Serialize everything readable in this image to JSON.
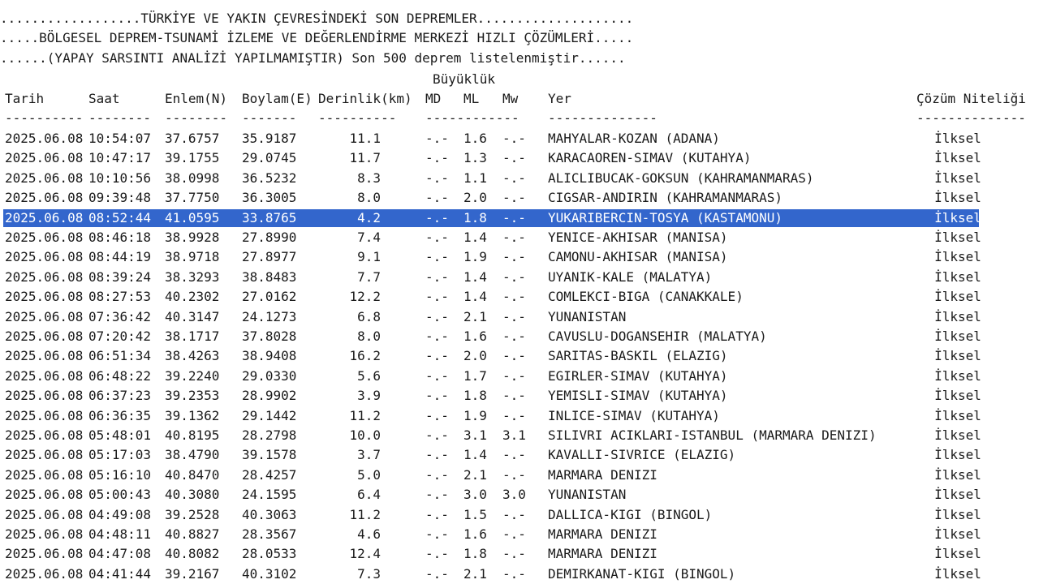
{
  "header": {
    "line1": "..................TÜRKİYE VE YAKIN ÇEVRESİNDEKİ SON DEPREMLER....................",
    "line2": ".....BÖLGESEL DEPREM-TSUNAMİ İZLEME VE DEĞERLENDİRME MERKEZİ HIZLI ÇÖZÜMLERİ.....",
    "line3": "......(YAPAY SARSINTI ANALİZİ YAPILMAMIŞTIR) Son 500 deprem listelenmiştir......",
    "magnitude_group": "Büyüklük"
  },
  "columns": {
    "tarih": "Tarih",
    "saat": "Saat",
    "enlem": "Enlem(N)",
    "boylam": "Boylam(E)",
    "derinlik": "Derinlik(km)",
    "md": "MD",
    "ml": "ML",
    "mw": "Mw",
    "yer": "Yer",
    "nitelik": "Çözüm Niteliği"
  },
  "separators": {
    "tarih": "----------",
    "saat": "--------",
    "enlem": "--------",
    "boylam": "-------",
    "derinlik": "----------",
    "mag": "------------",
    "yer": "--------------",
    "nitelik": "--------------"
  },
  "selected_row_index": 4,
  "rows": [
    {
      "date": "2025.06.08",
      "time": "10:54:07",
      "lat": "37.6757",
      "lon": "35.9187",
      "depth": "11.1",
      "md": "-.-",
      "ml": "1.6",
      "mw": "-.-",
      "place": "MAHYALAR-KOZAN (ADANA)",
      "quality": "İlksel"
    },
    {
      "date": "2025.06.08",
      "time": "10:47:17",
      "lat": "39.1755",
      "lon": "29.0745",
      "depth": "11.7",
      "md": "-.-",
      "ml": "1.3",
      "mw": "-.-",
      "place": "KARACAOREN-SIMAV (KUTAHYA)",
      "quality": "İlksel"
    },
    {
      "date": "2025.06.08",
      "time": "10:10:56",
      "lat": "38.0998",
      "lon": "36.5232",
      "depth": "8.3",
      "md": "-.-",
      "ml": "1.1",
      "mw": "-.-",
      "place": "ALICLIBUCAK-GOKSUN (KAHRAMANMARAS)",
      "quality": "İlksel"
    },
    {
      "date": "2025.06.08",
      "time": "09:39:48",
      "lat": "37.7750",
      "lon": "36.3005",
      "depth": "8.0",
      "md": "-.-",
      "ml": "2.0",
      "mw": "-.-",
      "place": "CIGSAR-ANDIRIN (KAHRAMANMARAS)",
      "quality": "İlksel"
    },
    {
      "date": "2025.06.08",
      "time": "08:52:44",
      "lat": "41.0595",
      "lon": "33.8765",
      "depth": "4.2",
      "md": "-.-",
      "ml": "1.8",
      "mw": "-.-",
      "place": "YUKARIBERCIN-TOSYA (KASTAMONU)",
      "quality": "İlksel"
    },
    {
      "date": "2025.06.08",
      "time": "08:46:18",
      "lat": "38.9928",
      "lon": "27.8990",
      "depth": "7.4",
      "md": "-.-",
      "ml": "1.4",
      "mw": "-.-",
      "place": "YENICE-AKHISAR (MANISA)",
      "quality": "İlksel"
    },
    {
      "date": "2025.06.08",
      "time": "08:44:19",
      "lat": "38.9718",
      "lon": "27.8977",
      "depth": "9.1",
      "md": "-.-",
      "ml": "1.9",
      "mw": "-.-",
      "place": "CAMONU-AKHISAR (MANISA)",
      "quality": "İlksel"
    },
    {
      "date": "2025.06.08",
      "time": "08:39:24",
      "lat": "38.3293",
      "lon": "38.8483",
      "depth": "7.7",
      "md": "-.-",
      "ml": "1.4",
      "mw": "-.-",
      "place": "UYANIK-KALE (MALATYA)",
      "quality": "İlksel"
    },
    {
      "date": "2025.06.08",
      "time": "08:27:53",
      "lat": "40.2302",
      "lon": "27.0162",
      "depth": "12.2",
      "md": "-.-",
      "ml": "1.4",
      "mw": "-.-",
      "place": "COMLEKCI-BIGA (CANAKKALE)",
      "quality": "İlksel"
    },
    {
      "date": "2025.06.08",
      "time": "07:36:42",
      "lat": "40.3147",
      "lon": "24.1273",
      "depth": "6.8",
      "md": "-.-",
      "ml": "2.1",
      "mw": "-.-",
      "place": "YUNANISTAN",
      "quality": "İlksel"
    },
    {
      "date": "2025.06.08",
      "time": "07:20:42",
      "lat": "38.1717",
      "lon": "37.8028",
      "depth": "8.0",
      "md": "-.-",
      "ml": "1.6",
      "mw": "-.-",
      "place": "CAVUSLU-DOGANSEHIR (MALATYA)",
      "quality": "İlksel"
    },
    {
      "date": "2025.06.08",
      "time": "06:51:34",
      "lat": "38.4263",
      "lon": "38.9408",
      "depth": "16.2",
      "md": "-.-",
      "ml": "2.0",
      "mw": "-.-",
      "place": "SARITAS-BASKIL (ELAZIG)",
      "quality": "İlksel"
    },
    {
      "date": "2025.06.08",
      "time": "06:48:22",
      "lat": "39.2240",
      "lon": "29.0330",
      "depth": "5.6",
      "md": "-.-",
      "ml": "1.7",
      "mw": "-.-",
      "place": "EGIRLER-SIMAV (KUTAHYA)",
      "quality": "İlksel"
    },
    {
      "date": "2025.06.08",
      "time": "06:37:23",
      "lat": "39.2353",
      "lon": "28.9902",
      "depth": "3.9",
      "md": "-.-",
      "ml": "1.8",
      "mw": "-.-",
      "place": "YEMISLI-SIMAV (KUTAHYA)",
      "quality": "İlksel"
    },
    {
      "date": "2025.06.08",
      "time": "06:36:35",
      "lat": "39.1362",
      "lon": "29.1442",
      "depth": "11.2",
      "md": "-.-",
      "ml": "1.9",
      "mw": "-.-",
      "place": "INLICE-SIMAV (KUTAHYA)",
      "quality": "İlksel"
    },
    {
      "date": "2025.06.08",
      "time": "05:48:01",
      "lat": "40.8195",
      "lon": "28.2798",
      "depth": "10.0",
      "md": "-.-",
      "ml": "3.1",
      "mw": "3.1",
      "place": "SILIVRI ACIKLARI-ISTANBUL (MARMARA DENIZI)",
      "quality": "İlksel"
    },
    {
      "date": "2025.06.08",
      "time": "05:17:03",
      "lat": "38.4790",
      "lon": "39.1578",
      "depth": "3.7",
      "md": "-.-",
      "ml": "1.4",
      "mw": "-.-",
      "place": "KAVALLI-SIVRICE (ELAZIG)",
      "quality": "İlksel"
    },
    {
      "date": "2025.06.08",
      "time": "05:16:10",
      "lat": "40.8470",
      "lon": "28.4257",
      "depth": "5.0",
      "md": "-.-",
      "ml": "2.1",
      "mw": "-.-",
      "place": "MARMARA DENIZI",
      "quality": "İlksel"
    },
    {
      "date": "2025.06.08",
      "time": "05:00:43",
      "lat": "40.3080",
      "lon": "24.1595",
      "depth": "6.4",
      "md": "-.-",
      "ml": "3.0",
      "mw": "3.0",
      "place": "YUNANISTAN",
      "quality": "İlksel"
    },
    {
      "date": "2025.06.08",
      "time": "04:49:08",
      "lat": "39.2528",
      "lon": "40.3063",
      "depth": "11.2",
      "md": "-.-",
      "ml": "1.5",
      "mw": "-.-",
      "place": "DALLICA-KIGI (BINGOL)",
      "quality": "İlksel"
    },
    {
      "date": "2025.06.08",
      "time": "04:48:11",
      "lat": "40.8827",
      "lon": "28.3567",
      "depth": "4.6",
      "md": "-.-",
      "ml": "1.6",
      "mw": "-.-",
      "place": "MARMARA DENIZI",
      "quality": "İlksel"
    },
    {
      "date": "2025.06.08",
      "time": "04:47:08",
      "lat": "40.8082",
      "lon": "28.0533",
      "depth": "12.4",
      "md": "-.-",
      "ml": "1.8",
      "mw": "-.-",
      "place": "MARMARA DENIZI",
      "quality": "İlksel"
    },
    {
      "date": "2025.06.08",
      "time": "04:41:44",
      "lat": "39.2167",
      "lon": "40.3102",
      "depth": "7.3",
      "md": "-.-",
      "ml": "2.1",
      "mw": "-.-",
      "place": "DEMIRKANAT-KIGI (BINGOL)",
      "quality": "İlksel"
    }
  ],
  "colors": {
    "selection": "#3366cc",
    "selection_text": "#ffffff",
    "text": "#1a1a1a",
    "background": "#ffffff"
  }
}
